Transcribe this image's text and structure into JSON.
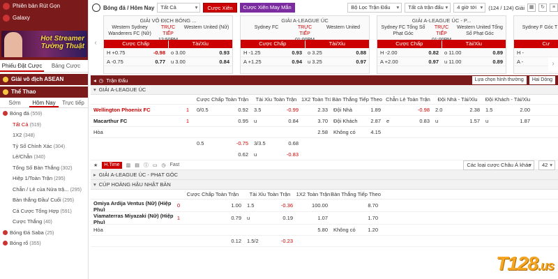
{
  "sidebar": {
    "link1": "Phiên bản Rút Gọn",
    "link2": "Galaxy",
    "banner_line1": "Hot Streamer",
    "banner_line2": "Tường Thuật",
    "tabs": [
      "Phiếu Đặt Cược",
      "Bảng Cược"
    ],
    "section1": "Giải vô địch ASEAN",
    "section2": "Thể Thao",
    "subtabs": [
      "Sớm",
      "Hôm Nay",
      "Trực tiếp"
    ],
    "items": [
      {
        "label": "Bóng đá",
        "count": "(559)",
        "type": "cat"
      },
      {
        "label": "Tất Cả",
        "count": "(519)",
        "type": "sel"
      },
      {
        "label": "1X2",
        "count": "(348)",
        "type": "item"
      },
      {
        "label": "Tỷ Số Chính Xác",
        "count": "(304)",
        "type": "item"
      },
      {
        "label": "Lẻ/Chẵn",
        "count": "(340)",
        "type": "item"
      },
      {
        "label": "Tổng Số Bàn Thắng",
        "count": "(302)",
        "type": "item"
      },
      {
        "label": "Hiệp 1/Toàn Trận",
        "count": "(295)",
        "type": "item"
      },
      {
        "label": "Chẵn / Lẻ của Nửa trậ...",
        "count": "(295)",
        "type": "item"
      },
      {
        "label": "Bàn thắng Đầu/ Cuối",
        "count": "(295)",
        "type": "item"
      },
      {
        "label": "Cá Cược Tổng Hợp",
        "count": "(591)",
        "type": "item"
      },
      {
        "label": "Cược Thắng",
        "count": "(40)",
        "type": "item"
      },
      {
        "label": "Bóng Đá Saba",
        "count": "(25)",
        "type": "cat"
      },
      {
        "label": "Bóng rổ",
        "count": "(355)",
        "type": "cat"
      }
    ]
  },
  "topbar": {
    "title": "Bóng đá / Hôm Nay",
    "select1": "Tất Cả",
    "btn_cuoc_xien": "Cược Xiên",
    "btn_cuoc_xien_may_man": "Cược Xiên May Mắn",
    "filter": "Bộ Lọc Trận Đấu",
    "sort": "Tất cả trận đấu",
    "time": "4 giờ tới",
    "count": "(124 / 124) Giải"
  },
  "cards": [
    {
      "league": "GIẢI VÔ ĐỊCH BÓNG ...",
      "home": "Western Sydney Wanderers FC (Nữ)",
      "away": "Western United (Nữ)",
      "live": "TRỰC TIẾP",
      "time": "12:50PM",
      "h1": "Cược Chấp",
      "h2": "Tài/Xỉu",
      "rows": [
        [
          "H +0.75",
          "-0.98",
          "o 3.00",
          "0.93"
        ],
        [
          "A -0.75",
          "0.77",
          "u 3.00",
          "0.84"
        ]
      ]
    },
    {
      "league": "GIẢI A-LEAGUE ÚC",
      "home": "Sydney FC",
      "away": "Western United",
      "live": "TRỰC TIẾP",
      "time": "01:00PM",
      "h1": "Cược Chấp",
      "h2": "Tài/Xỉu",
      "rows": [
        [
          "H -1.25",
          "0.93",
          "o 3.25",
          "0.88"
        ],
        [
          "A +1.25",
          "0.94",
          "u 3.25",
          "0.97"
        ]
      ]
    },
    {
      "league": "GIẢI A-LEAGUE ÚC - P...",
      "home": "Sydney FC Tổng Số Phạt Góc",
      "away": "Western United Tổng Số Phạt Góc",
      "live": "TRỰC TIẾP",
      "time": "01:00PM",
      "h1": "Cược Chấp",
      "h2": "Tài/Xỉu",
      "rows": [
        [
          "H -2.00",
          "0.82",
          "o 11.00",
          "0.89"
        ],
        [
          "A +2.00",
          "0.97",
          "u 11.00",
          "0.89"
        ]
      ]
    },
    {
      "league": "",
      "home": "Sydney F Góc T",
      "away": "",
      "live": "",
      "time": "",
      "h1": "Cư",
      "h2": "",
      "rows": [
        [
          "H -",
          "",
          "",
          ""
        ],
        [
          "A -",
          "",
          "",
          ""
        ]
      ]
    }
  ],
  "section": {
    "title": "Trận Đấu",
    "view": "Lựa chọn hình thường",
    "lines": "Hai Dòng"
  },
  "league1": {
    "name": "GIẢI A-LEAGUE ÚC",
    "headers": [
      "Cược Chấp Toàn Trận",
      "Tài Xỉu Toàn Trận",
      "1X2 Toàn Trận",
      "Bàn Thắng Tiếp Theo",
      "Chẵn Lẻ Toàn Trận",
      "Đội Nhà - Tài/Xỉu",
      "Đội Khách - Tài/Xỉu"
    ],
    "home": "Wellington Phoenix FC",
    "away": "Macarthur FC",
    "draw": "Hòa",
    "home_score": "1",
    "away_score": "1",
    "r1": [
      "0/0.5",
      "0.92",
      "3.5",
      "-0.99",
      "2.33",
      "Đội Nhà",
      "1.89",
      "",
      "-0.98",
      "2.0",
      "2.38",
      "1.5",
      "2.00"
    ],
    "r2": [
      "",
      "0.95",
      "u",
      "0.84",
      "3.70",
      "Đội Khách",
      "2.87",
      "e",
      "0.83",
      "u",
      "1.57",
      "u",
      "1.87"
    ],
    "r3": [
      "",
      "",
      "",
      "",
      "2.58",
      "Không có",
      "4.15",
      "",
      "",
      "",
      "",
      "",
      ""
    ],
    "r4": [
      "0.5",
      "-0.75",
      "3/3.5",
      "0.68"
    ],
    "r5": [
      "",
      "0.62",
      "u",
      "-0.83"
    ]
  },
  "controls": {
    "htime": "H.Time",
    "fast": "Fast",
    "odds_type": "Các loại cược Châu Á khác",
    "more": "42"
  },
  "league2": {
    "name": "GIẢI A-LEAGUE ÚC - PHẠT GÓC"
  },
  "league3": {
    "name": "CÚP HOÀNG HẬU NHẬT BẢN",
    "headers": [
      "Cược Chấp Toàn Trận",
      "Tài Xỉu Toàn Trận",
      "1X2 Toàn Trận",
      "Bàn Thắng Tiếp Theo"
    ],
    "home": "Omiya Ardija Ventus (Nữ) (Hiệp Phụ)",
    "away": "Viamaterras Miyazaki (Nữ) (Hiệp Phụ)",
    "draw": "Hòa",
    "home_score": "0",
    "away_score": "1",
    "r1": [
      "",
      "1.00",
      "1.5",
      "-0.36",
      "100.00",
      "",
      "8.70"
    ],
    "r2": [
      "",
      "0.79",
      "u",
      "0.19",
      "1.07",
      "",
      "1.70"
    ],
    "r3": [
      "",
      "",
      "",
      "",
      "5.80",
      "Không có",
      "1.20"
    ],
    "r4": [
      "",
      "0.12",
      "1.5/2",
      "-0.23"
    ]
  },
  "watermark": {
    "brand": "T128",
    "tld": ".us"
  },
  "colors": {
    "brand_red": "#c00000",
    "dark_red": "#7a1a1a",
    "purple": "#7b2ca0",
    "watermark": "#f5a623"
  }
}
